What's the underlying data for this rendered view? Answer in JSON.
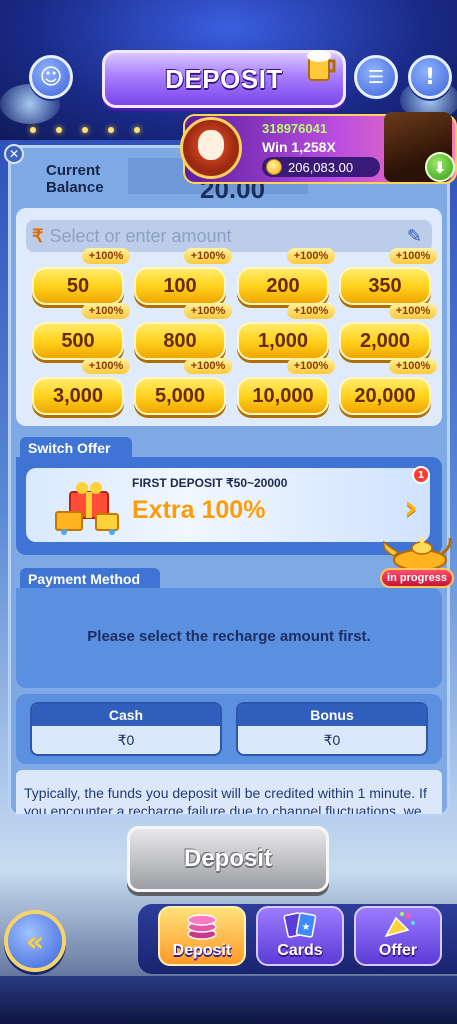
{
  "header": {
    "title": "DEPOSIT",
    "icons": [
      "support-icon",
      "list-icon",
      "alert-icon"
    ]
  },
  "player": {
    "uid": "318976041",
    "win": "Win 1,258X",
    "coins": "206,083.00"
  },
  "balance": {
    "label_line1": "Current",
    "label_line2": "Balance",
    "value": "20.00"
  },
  "amount_input": {
    "currency": "₹",
    "placeholder": "Select or enter amount"
  },
  "amounts": [
    {
      "value": "50",
      "bonus": "+100%"
    },
    {
      "value": "100",
      "bonus": "+100%"
    },
    {
      "value": "200",
      "bonus": "+100%"
    },
    {
      "value": "350",
      "bonus": "+100%"
    },
    {
      "value": "500",
      "bonus": "+100%"
    },
    {
      "value": "800",
      "bonus": "+100%"
    },
    {
      "value": "1,000",
      "bonus": "+100%"
    },
    {
      "value": "2,000",
      "bonus": "+100%"
    },
    {
      "value": "3,000",
      "bonus": "+100%"
    },
    {
      "value": "5,000",
      "bonus": "+100%"
    },
    {
      "value": "10,000",
      "bonus": "+100%"
    },
    {
      "value": "20,000",
      "bonus": "+100%"
    }
  ],
  "offer": {
    "section_title": "Switch Offer",
    "subtitle": "FIRST DEPOSIT ₹50~20000",
    "headline": "Extra 100%",
    "count_badge": "1",
    "status": "in progress"
  },
  "payment": {
    "section_title": "Payment Method",
    "message": "Please select the recharge amount first."
  },
  "wallet": {
    "cash_label": "Cash",
    "cash_value": "₹0",
    "bonus_label": "Bonus",
    "bonus_value": "₹0"
  },
  "notice": "Typically, the funds you deposit will be credited within 1 minute. If you encounter a recharge failure due to channel fluctuations, we",
  "deposit_button": "Deposit",
  "bottom_nav": [
    {
      "label": "Deposit",
      "icon": "chips-icon",
      "active": true
    },
    {
      "label": "Cards",
      "icon": "cards-icon",
      "active": false
    },
    {
      "label": "Offer",
      "icon": "party-popper-icon",
      "active": false
    }
  ],
  "colors": {
    "accent_gold": "#ffd21e",
    "panel_blue": "#7fa9e4",
    "tab_purple": "#7a45e8"
  }
}
